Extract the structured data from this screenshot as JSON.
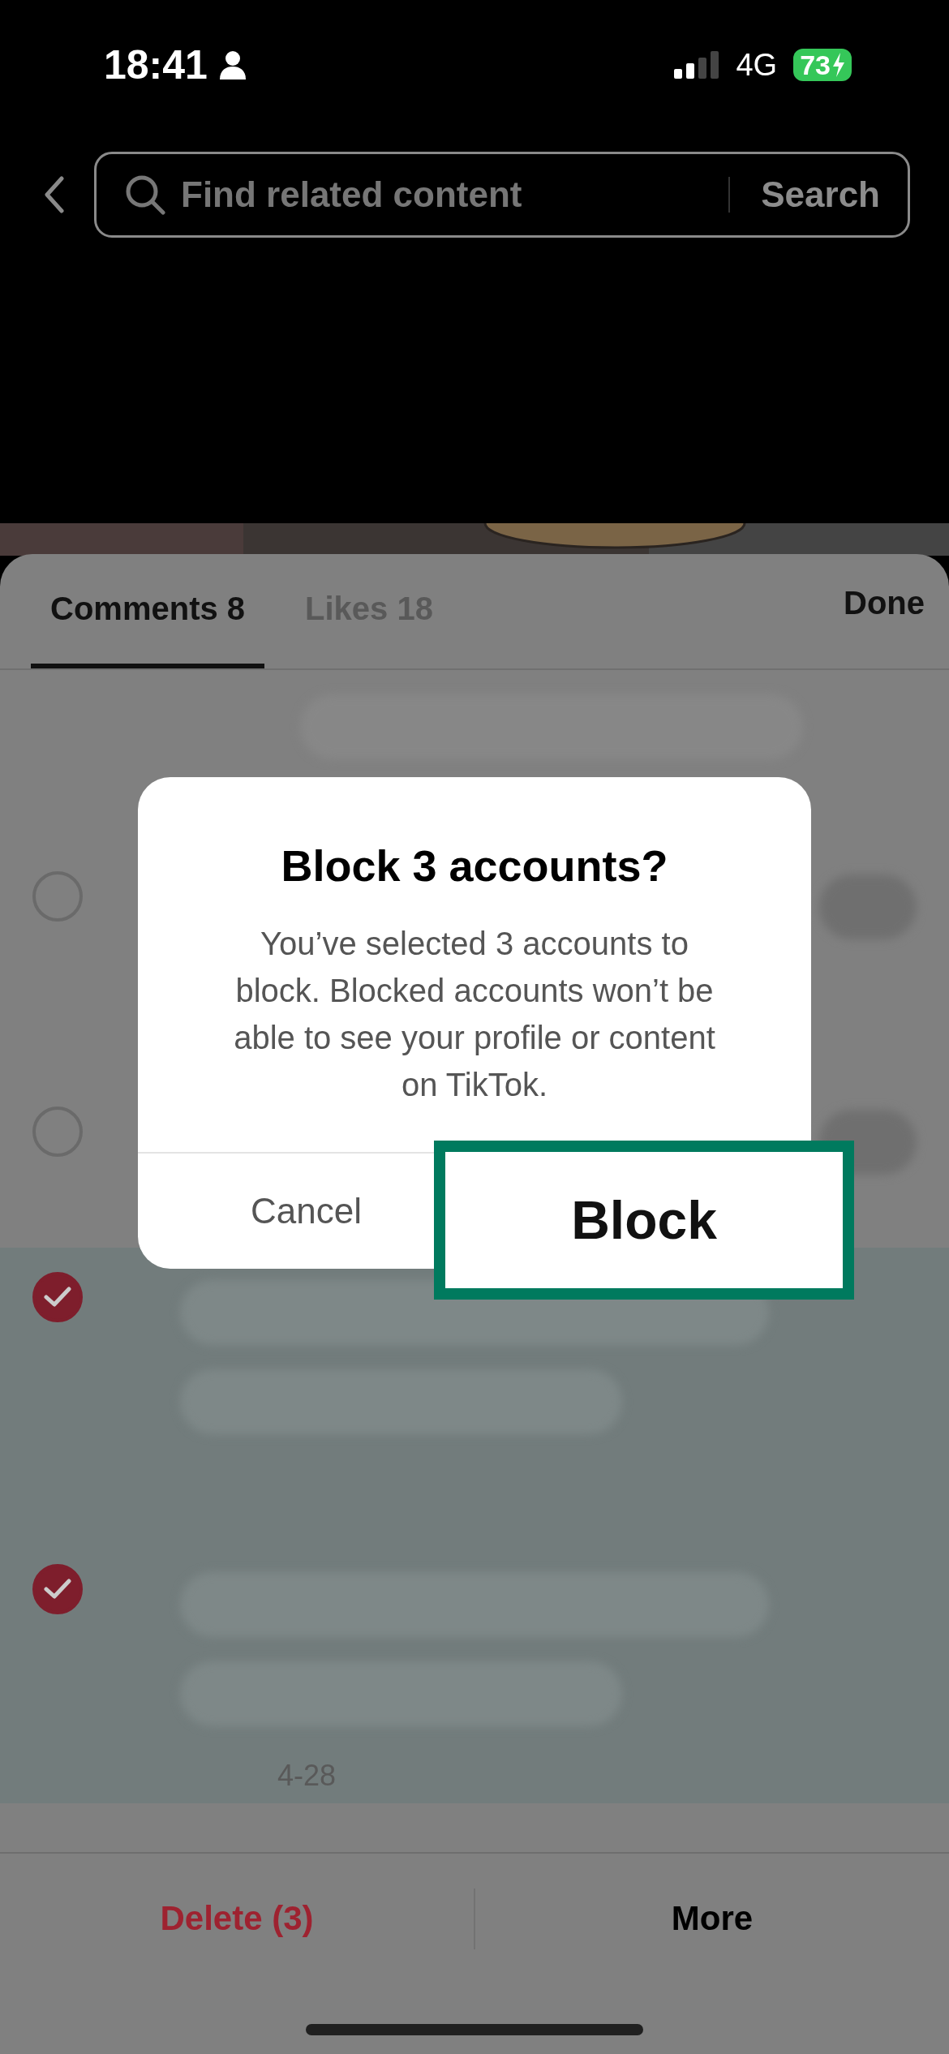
{
  "status_bar": {
    "time": "18:41",
    "network": "4G",
    "battery": "73",
    "charging": true
  },
  "search": {
    "placeholder": "Find related content",
    "button": "Search"
  },
  "tabs": [
    {
      "label": "Comments 8",
      "selected": true
    },
    {
      "label": "Likes 18",
      "selected": false
    }
  ],
  "done": "Done",
  "comments": [
    {
      "selected": false
    },
    {
      "selected": false
    },
    {
      "selected": true
    },
    {
      "selected": true,
      "date": "4-28"
    }
  ],
  "dialog": {
    "title": "Block 3 accounts?",
    "message": "You’ve selected 3 accounts to block. Blocked accounts won’t be able to see your profile or content on TikTok.",
    "cancel": "Cancel",
    "confirm": "Block",
    "confirm_highlighted": true
  },
  "actions": [
    {
      "label": "Delete (3)",
      "kind": "destructive"
    },
    {
      "label": "More",
      "kind": "normal"
    }
  ]
}
